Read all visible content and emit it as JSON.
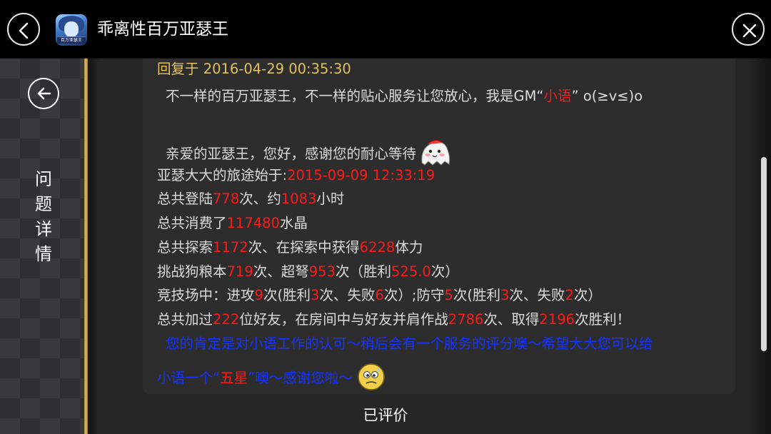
{
  "header": {
    "title": "乖离性百万亚瑟王",
    "app_icon_tag": "百万亚瑟王"
  },
  "sidebar": {
    "title": "问\n题\n详\n情"
  },
  "reply": {
    "time_label": "回复于 2016-04-29 00:35:30",
    "intro_prefix": "不一样的百万亚瑟王，不一样的贴心服务让您放心，我是GM“",
    "intro_name": "小语",
    "intro_suffix": "” o(≥v≤)o",
    "greeting": "亲爱的亚瑟王，您好，感谢您的耐心等待",
    "journey_label": "亚瑟大大的旅途始于:",
    "journey_date": "2015-09-09 12:33:19",
    "login": {
      "p1": "总共登陆",
      "count": "778",
      "p2": "次、约",
      "hours": "1083",
      "p3": "小时"
    },
    "spend": {
      "p1": "总共消费了",
      "crystals": "117480",
      "p2": "水晶"
    },
    "explore": {
      "p1": "总共探索",
      "count": "1172",
      "p2": "次、在探索中获得",
      "stamina": "6228",
      "p3": "体力"
    },
    "challenge": {
      "p1": "挑战狗粮本",
      "count": "719",
      "p2": "次、超弩",
      "hard": "953",
      "p3": "次（胜利",
      "wins": "525.0",
      "p4": "次）"
    },
    "arena": {
      "p1": "竞技场中：进攻",
      "atk": "9",
      "p2": "次(胜利",
      "atk_win": "3",
      "p3": "次、失败",
      "atk_lose": "6",
      "p4": "次）;防守",
      "def": "5",
      "p5": "次(胜利",
      "def_win": "3",
      "p6": "次、失败",
      "def_lose": "2",
      "p7": "次）"
    },
    "friends": {
      "p1": "总共加过",
      "count": "222",
      "p2": "位好友，在房间中与好友并肩作战",
      "battles": "2786",
      "p3": "次、取得",
      "wins": "2196",
      "p4": "次胜利！"
    },
    "survey_line1": "您的肯定是对小语工作的认可～稍后会有一个服务的评分噢～希望大大您可以给",
    "survey_line2_a": "小语一个“",
    "survey_star": "五星",
    "survey_line2_b": "”噢～感谢您啦～"
  },
  "footer": {
    "status": "已评价"
  },
  "colors": {
    "gold": "#e3c15f",
    "red": "#ff1a1a",
    "blue": "#1633ff",
    "text": "#dcdcdc"
  },
  "icons": {
    "back": "chevron-left-icon",
    "close": "close-icon",
    "panel_back": "arrow-left-icon",
    "emoji1": "ghost-emoji-icon",
    "emoji2": "worried-face-emoji-icon"
  }
}
